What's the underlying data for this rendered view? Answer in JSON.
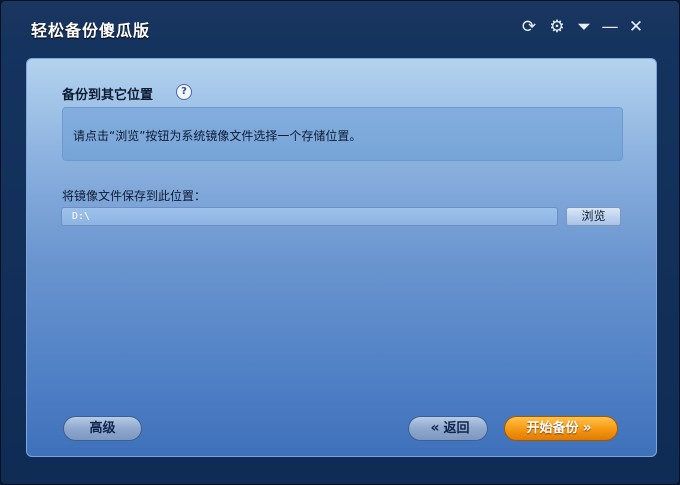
{
  "window": {
    "title": "轻松备份傻瓜版",
    "controls": [
      {
        "name": "refresh-icon",
        "glyph": "⟳"
      },
      {
        "name": "gear-icon",
        "glyph": "⚙"
      },
      {
        "name": "menu-dropdown-icon",
        "glyph": "⏷"
      },
      {
        "name": "minimize-icon",
        "glyph": "—"
      },
      {
        "name": "close-icon",
        "glyph": "✕"
      }
    ]
  },
  "panel": {
    "heading": "备份到其它位置",
    "help_glyph": "?",
    "info_text": "请点击“浏览”按钮为系统镜像文件选择一个存储位置。",
    "path_label": "将镜像文件保存到此位置：",
    "path_value": "D:\\",
    "browse_label": "浏览"
  },
  "footer": {
    "advanced_label": "高级",
    "back_label": "返回",
    "back_icon": "«",
    "start_label": "开始备份",
    "start_icon": "»"
  },
  "colors": {
    "accent": "#f79a16",
    "title_text": "#ffffff",
    "panel_top": "#b3d3ee",
    "panel_bottom": "#3f71bb"
  }
}
